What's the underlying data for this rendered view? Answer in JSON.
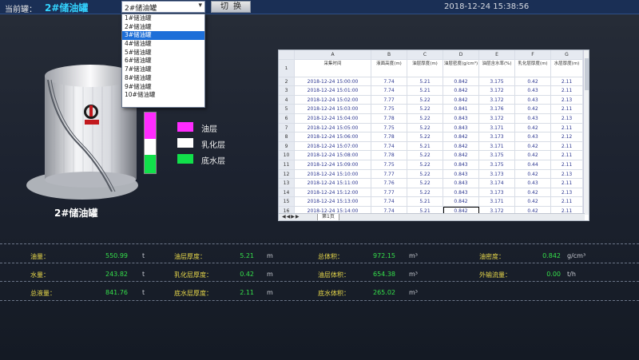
{
  "header": {
    "current_label": "当前罐：",
    "current_value": "2#储油罐",
    "select_value": "2#储油罐",
    "switch_label": "切换",
    "datetime": "2018-12-24 15:38:56"
  },
  "dropdown": {
    "options": [
      "1#储油罐",
      "2#储油罐",
      "3#储油罐",
      "4#储油罐",
      "5#储油罐",
      "6#储油罐",
      "7#储油罐",
      "8#储油罐",
      "9#储油罐",
      "10#储油罐"
    ],
    "highlighted": "3#储油罐"
  },
  "tank": {
    "caption": "2#储油罐",
    "levels": {
      "oil": 0.44,
      "emulsion": 0.26,
      "water": 0.3
    }
  },
  "legend": [
    {
      "label": "油层",
      "color": "#ff2bff"
    },
    {
      "label": "乳化层",
      "color": "#ffffff"
    },
    {
      "label": "底水层",
      "color": "#11e04a"
    }
  ],
  "sheet": {
    "col_letters": [
      "",
      "A",
      "B",
      "C",
      "D",
      "E",
      "F",
      "G"
    ],
    "title_cells": [
      "采集时间",
      "液面高度(m)",
      "油层厚度(m)",
      "油层密度(g/cm³)",
      "油层含水率(%)",
      "乳化层厚度(m)",
      "水层厚度(m)"
    ],
    "rows": [
      {
        "num": "2",
        "cells": [
          "2018-12-24 15:00:00",
          "7.74",
          "5.21",
          "0.842",
          "3.175",
          "0.42",
          "2.11"
        ]
      },
      {
        "num": "3",
        "cells": [
          "2018-12-24 15:01:00",
          "7.74",
          "5.21",
          "0.842",
          "3.172",
          "0.43",
          "2.11"
        ]
      },
      {
        "num": "4",
        "cells": [
          "2018-12-24 15:02:00",
          "7.77",
          "5.22",
          "0.842",
          "3.172",
          "0.43",
          "2.13"
        ]
      },
      {
        "num": "5",
        "cells": [
          "2018-12-24 15:03:00",
          "7.75",
          "5.22",
          "0.841",
          "3.176",
          "0.42",
          "2.11"
        ]
      },
      {
        "num": "6",
        "cells": [
          "2018-12-24 15:04:00",
          "7.78",
          "5.22",
          "0.843",
          "3.172",
          "0.43",
          "2.13"
        ]
      },
      {
        "num": "7",
        "cells": [
          "2018-12-24 15:05:00",
          "7.75",
          "5.22",
          "0.843",
          "3.171",
          "0.42",
          "2.11"
        ]
      },
      {
        "num": "8",
        "cells": [
          "2018-12-24 15:06:00",
          "7.78",
          "5.22",
          "0.842",
          "3.173",
          "0.43",
          "2.12"
        ]
      },
      {
        "num": "9",
        "cells": [
          "2018-12-24 15:07:00",
          "7.74",
          "5.21",
          "0.842",
          "3.171",
          "0.42",
          "2.11"
        ]
      },
      {
        "num": "10",
        "cells": [
          "2018-12-24 15:08:00",
          "7.78",
          "5.22",
          "0.842",
          "3.175",
          "0.42",
          "2.11"
        ]
      },
      {
        "num": "11",
        "cells": [
          "2018-12-24 15:09:00",
          "7.75",
          "5.22",
          "0.843",
          "3.175",
          "0.44",
          "2.11"
        ]
      },
      {
        "num": "12",
        "cells": [
          "2018-12-24 15:10:00",
          "7.77",
          "5.22",
          "0.843",
          "3.173",
          "0.42",
          "2.13"
        ]
      },
      {
        "num": "13",
        "cells": [
          "2018-12-24 15:11:00",
          "7.76",
          "5.22",
          "0.843",
          "3.174",
          "0.43",
          "2.11"
        ]
      },
      {
        "num": "14",
        "cells": [
          "2018-12-24 15:12:00",
          "7.77",
          "5.22",
          "0.843",
          "3.173",
          "0.42",
          "2.13"
        ]
      },
      {
        "num": "15",
        "cells": [
          "2018-12-24 15:13:00",
          "7.74",
          "5.21",
          "0.842",
          "3.171",
          "0.42",
          "2.11"
        ]
      },
      {
        "num": "16",
        "cells": [
          "2018-12-24 15:14:00",
          "7.74",
          "5.21",
          "0.842",
          "3.172",
          "0.42",
          "2.11"
        ]
      }
    ],
    "tab_nav": "◀◀▶▶",
    "tab_label": "第1页"
  },
  "stats": {
    "oil_qty": {
      "label": "油量：",
      "value": "550.99",
      "unit": "t"
    },
    "oil_thick": {
      "label": "油层厚度：",
      "value": "5.21",
      "unit": "m"
    },
    "total_vol": {
      "label": "总体积：",
      "value": "972.15",
      "unit": "m³"
    },
    "oil_density": {
      "label": "油密度：",
      "value": "0.842",
      "unit": "g/cm³"
    },
    "water_qty": {
      "label": "水量：",
      "value": "243.82",
      "unit": "t"
    },
    "emul_thick": {
      "label": "乳化层厚度：",
      "value": "0.42",
      "unit": "m"
    },
    "oil_vol": {
      "label": "油层体积：",
      "value": "654.38",
      "unit": "m³"
    },
    "outflow": {
      "label": "外输流量：",
      "value": "0.00",
      "unit": "t/h"
    },
    "total_qty": {
      "label": "总液量：",
      "value": "841.76",
      "unit": "t"
    },
    "water_thick": {
      "label": "底水层厚度：",
      "value": "2.11",
      "unit": "m"
    },
    "water_vol": {
      "label": "底水体积：",
      "value": "265.02",
      "unit": "m³"
    }
  }
}
